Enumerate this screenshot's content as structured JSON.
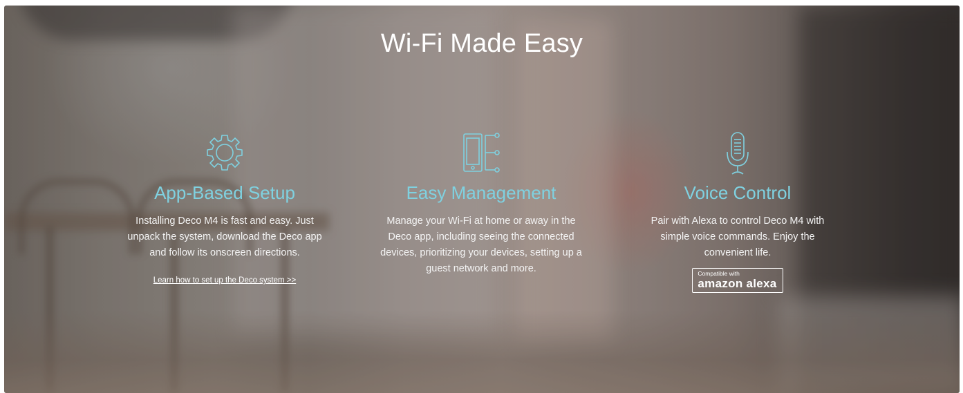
{
  "colors": {
    "accent": "#7fd1e0",
    "text": "#ffffff"
  },
  "section": {
    "title": "Wi-Fi Made Easy"
  },
  "features": [
    {
      "icon": "gear-icon",
      "title": "App-Based Setup",
      "description": "Installing Deco M4 is fast and easy. Just unpack the system, download the Deco app and follow its onscreen directions.",
      "link_text": "Learn how to set up the Deco system >>"
    },
    {
      "icon": "phone-network-icon",
      "title": "Easy Management",
      "description": "Manage your Wi-Fi at home or away in the Deco app, including seeing the connected devices, prioritizing your devices, setting up a guest network and more."
    },
    {
      "icon": "microphone-icon",
      "title": "Voice Control",
      "description": "Pair with Alexa to control Deco M4 with simple voice commands. Enjoy the convenient life.",
      "badge_small": "Compatible with",
      "badge_large": "amazon alexa"
    }
  ]
}
